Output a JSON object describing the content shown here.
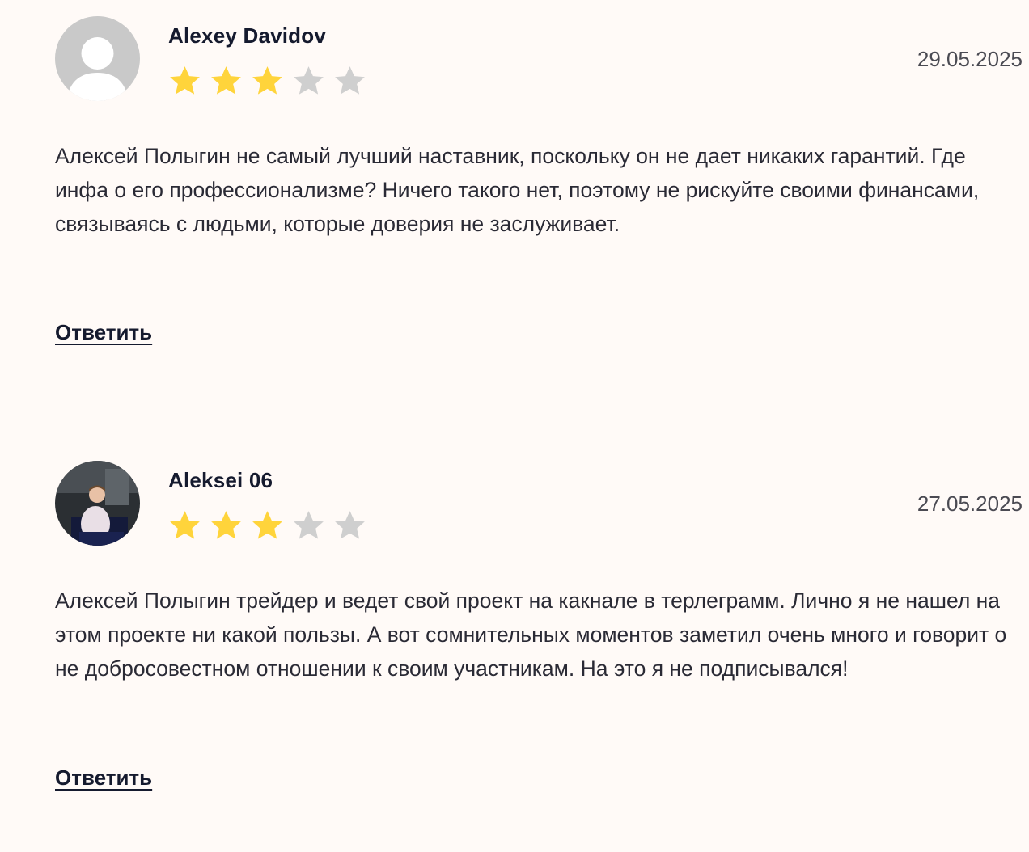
{
  "reviews": [
    {
      "author": "Alexey Davidov",
      "date": "29.05.2025",
      "rating": 3,
      "rating_max": 5,
      "avatar": "default-user-avatar",
      "text": "Алексей Полыгин не самый лучший наставник, поскольку он не дает никаких гарантий. Где инфа о его профессионализме? Ничего такого нет, поэтому не рискуйте своими финансами, связываясь с людьми, которые доверия не заслуживает.",
      "reply_label": "Ответить"
    },
    {
      "author": "Aleksei 06",
      "date": "27.05.2025",
      "rating": 3,
      "rating_max": 5,
      "avatar": "user-photo-avatar",
      "text": "Алексей Полыгин трейдер и ведет свой проект на какнале в терлеграмм. Лично я не нашел на этом проекте ни какой пользы. А вот сомнительных моментов заметил очень много и говорит о не добросовестном отношении к своим участникам. На это я не подписывался!",
      "reply_label": "Ответить"
    }
  ],
  "colors": {
    "background": "#fffaf7",
    "star_filled": "#ffd43b",
    "star_empty": "#cfcfcf",
    "text": "#2a2a35",
    "heading": "#151a2e"
  },
  "icons": {
    "star": "star-icon"
  }
}
